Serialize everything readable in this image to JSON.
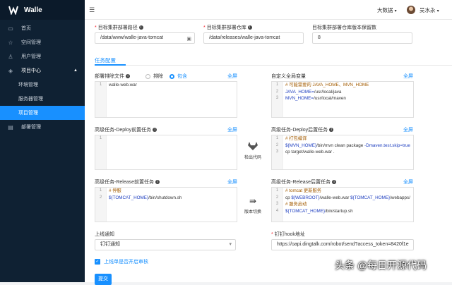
{
  "app": {
    "name": "Walle"
  },
  "sidebar": {
    "items": [
      {
        "label": "首页",
        "icon": "dashboard-icon"
      },
      {
        "label": "空间管理",
        "icon": "star-icon"
      },
      {
        "label": "用户管理",
        "icon": "user-icon"
      },
      {
        "label": "项目中心",
        "icon": "layers-icon"
      },
      {
        "label": "环境管理"
      },
      {
        "label": "服务器管理"
      },
      {
        "label": "项目管理"
      },
      {
        "label": "部署管理",
        "icon": "calendar-icon"
      }
    ]
  },
  "header": {
    "env": "大数据",
    "user": "吴水永"
  },
  "form": {
    "target_path_label": "目标集群部署路径",
    "target_path_value": "/data/www/walle-java-tomcat",
    "target_repo_label": "目标集群部署仓库",
    "target_repo_value": "/data/releases/walle-java-tomcat",
    "keep_label": "目标集群部署仓库版本保留数",
    "keep_value": "8",
    "section_tab": "任务配置",
    "exclude_label": "部署排除文件",
    "radio_exclude": "排除",
    "radio_include": "包含",
    "fullscreen": "全屏",
    "exclude_code": [
      "walle-web.war"
    ],
    "global_vars_label": "自定义全局变量",
    "global_vars_code": [
      "# 可能需要的 JAVA_HOME、MVN_HOME",
      "JAVA_HOME=/usr/local/java",
      "MVN_HOME=/usr/local/maven"
    ],
    "pre_deploy_label": "高级任务-Deploy前置任务",
    "pre_deploy_code": [
      ""
    ],
    "post_deploy_label": "高级任务-Deploy后置任务",
    "post_deploy_code": [
      "# 打包编译",
      "${MVN_HOME}/bin/mvn clean package -Dmaven.test.skip=true",
      "cp target/walle-web.war ."
    ],
    "checkout_label": "检出代码",
    "pre_release_label": "高级任务-Release前置任务",
    "pre_release_code": [
      "# 停服",
      "${TOMCAT_HOME}/bin/shutdown.sh"
    ],
    "switch_label": "版本切换",
    "post_release_label": "高级任务-Release后置任务",
    "post_release_code": [
      "# tomcat 更新服务",
      "cp ${WEBROOT}/walle-web.war ${TOMCAT_HOME}/webapps/",
      "# 服务启动",
      "${TOMCAT_HOME}/bin/startup.sh"
    ],
    "notify_label": "上线通知",
    "notify_value": "钉钉通知",
    "hook_label": "钉钉hook地址",
    "hook_value": "https://oapi.dingtalk.com/robot/send?access_token=8420f1e",
    "audit_label": "上线单是否开启审核",
    "submit_label": "提交"
  },
  "watermark": "头条 @每日开源代码",
  "colors": {
    "accent": "#1890ff",
    "sidebar": "#0f2133",
    "required": "#f5222d"
  }
}
